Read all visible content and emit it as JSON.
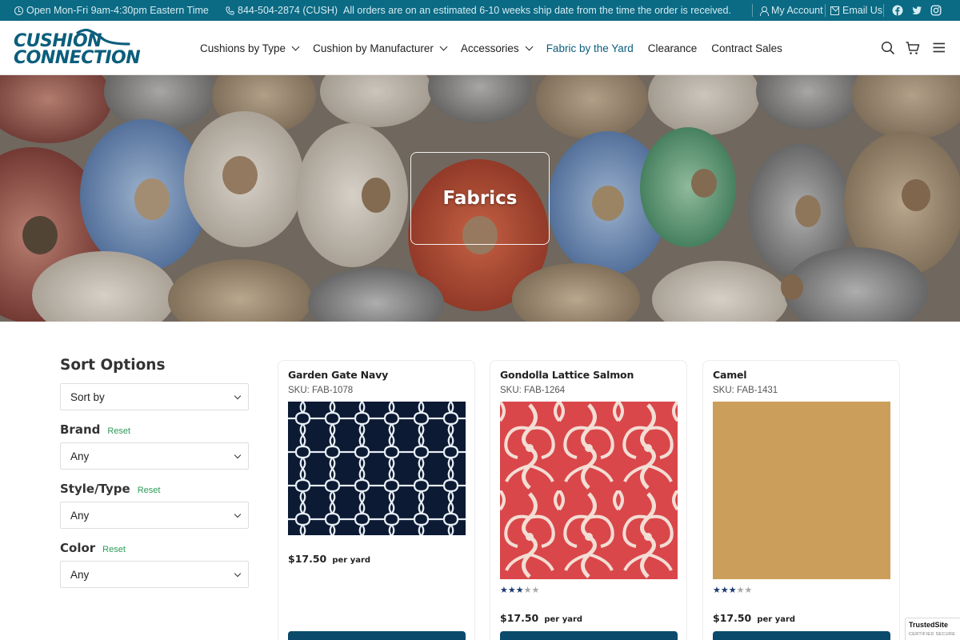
{
  "topbar": {
    "hours": "Open Mon-Fri 9am-4:30pm Eastern Time",
    "phone": "844-504-2874 (CUSH)",
    "shipping_notice": "All orders are on an estimated 6-10 weeks ship date from the time the order is received.",
    "account": "My Account",
    "email": "Email Us",
    "social": [
      "facebook-icon",
      "twitter-icon",
      "instagram-icon"
    ],
    "bg_color": "#0b6a84"
  },
  "brand": {
    "logo_line1": "CUSHION",
    "logo_line2": "CONNECTION",
    "color": "#0b5e7c"
  },
  "nav": {
    "items": [
      {
        "label": "Cushions by Type",
        "has_dropdown": true
      },
      {
        "label": "Cushion by Manufacturer",
        "has_dropdown": true
      },
      {
        "label": "Accessories",
        "has_dropdown": true
      },
      {
        "label": "Fabric by the Yard",
        "active": true
      },
      {
        "label": "Clearance"
      },
      {
        "label": "Contract Sales"
      }
    ],
    "icons": [
      "search-icon",
      "cart-icon",
      "menu-icon"
    ]
  },
  "hero": {
    "title": "Fabrics"
  },
  "sidebar": {
    "title": "Sort Options",
    "sort": {
      "value": "Sort by"
    },
    "filters": [
      {
        "label": "Brand",
        "reset": "Reset",
        "value": "Any"
      },
      {
        "label": "Style/Type",
        "reset": "Reset",
        "value": "Any"
      },
      {
        "label": "Color",
        "reset": "Reset",
        "value": "Any"
      }
    ]
  },
  "products": [
    {
      "name": "Garden Gate Navy",
      "sku_label": "SKU:",
      "sku": "FAB-1078",
      "price": "$17.50",
      "unit": "per yard",
      "rating": null,
      "swatch_color": "#0c1a33"
    },
    {
      "name": "Gondolla Lattice Salmon",
      "sku_label": "SKU:",
      "sku": "FAB-1264",
      "price": "$17.50",
      "unit": "per yard",
      "rating": 3,
      "rating_max": 5,
      "swatch_color": "#d9474a"
    },
    {
      "name": "Camel",
      "sku_label": "SKU:",
      "sku": "FAB-1431",
      "price": "$17.50",
      "unit": "per yard",
      "rating": 3,
      "rating_max": 5,
      "swatch_color": "#cfa15e"
    }
  ],
  "trust_badge": {
    "name": "TrustedSite",
    "tagline": "CERTIFIED SECURE"
  }
}
